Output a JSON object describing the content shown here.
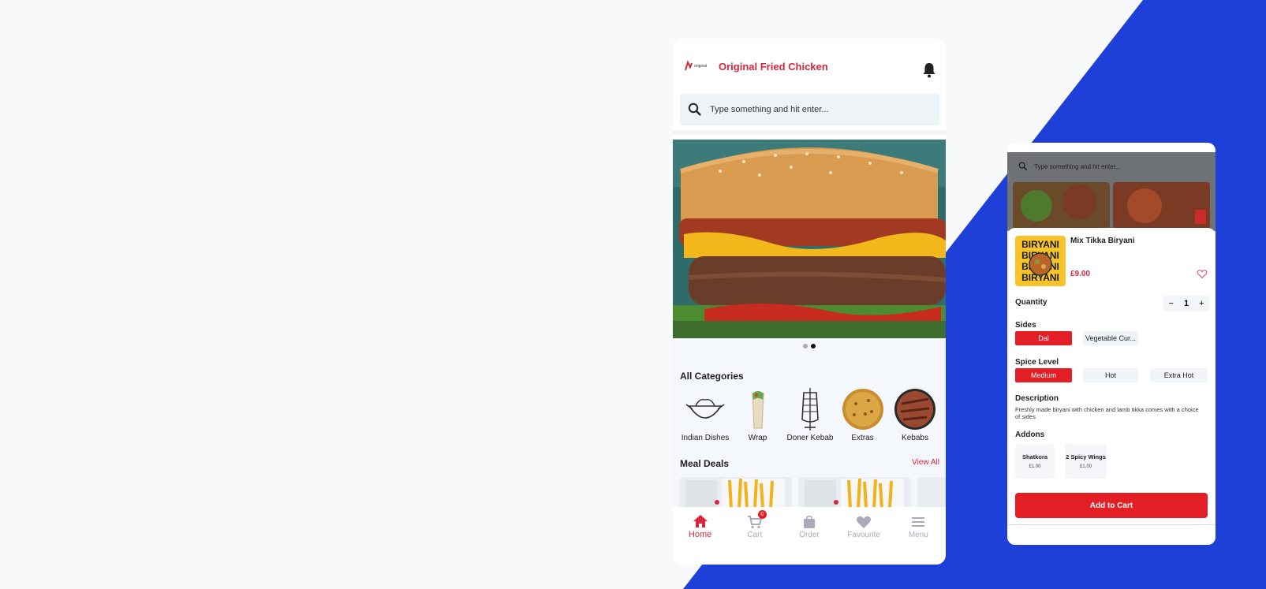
{
  "colors": {
    "brand_red": "#d7263d",
    "accent_red": "#e31e24",
    "blue": "#1e3fd8"
  },
  "app": {
    "title": "Original Fried Chicken",
    "logo_text": "original",
    "search_placeholder": "Type something and hit enter...",
    "carousel": {
      "count": 2,
      "active": 1
    },
    "categories_title": "All Categories",
    "categories": [
      {
        "label": "Indian Dishes",
        "icon": "indian-dish-icon"
      },
      {
        "label": "Wrap",
        "icon": "wrap-image"
      },
      {
        "label": "Doner Kebab",
        "icon": "doner-kebab-icon"
      },
      {
        "label": "Extras",
        "icon": "extras-image"
      },
      {
        "label": "Kebabs",
        "icon": "kebabs-image"
      }
    ],
    "meal_deals_title": "Meal Deals",
    "view_all": "View All",
    "cart_badge": "0",
    "nav": [
      {
        "label": "Home",
        "icon": "home-icon"
      },
      {
        "label": "Cart",
        "icon": "cart-icon"
      },
      {
        "label": "Order",
        "icon": "order-bag-icon"
      },
      {
        "label": "Favourite",
        "icon": "heart-icon"
      },
      {
        "label": "Menu",
        "icon": "menu-icon"
      }
    ]
  },
  "product": {
    "search_placeholder": "Type something and hit enter...",
    "image_text": "BIRYANI",
    "name": "Mix Tikka Biryani",
    "price": "£9.00",
    "quantity_label": "Quantity",
    "quantity": "1",
    "sides_label": "Sides",
    "sides": [
      "Dal",
      "Vegetable Cur..."
    ],
    "spice_label": "Spice Level",
    "spice": [
      "Medium",
      "Hot",
      "Extra Hot"
    ],
    "description_label": "Description",
    "description": "Freshly made biryani with chicken and lamb tikka comes with a choice of sides",
    "addons_label": "Addons",
    "addons": [
      {
        "name": "Shatkora",
        "price": "£1.00"
      },
      {
        "name": "2 Spicy Wings",
        "price": "£1.00"
      }
    ],
    "add_to_cart": "Add to Cart"
  }
}
